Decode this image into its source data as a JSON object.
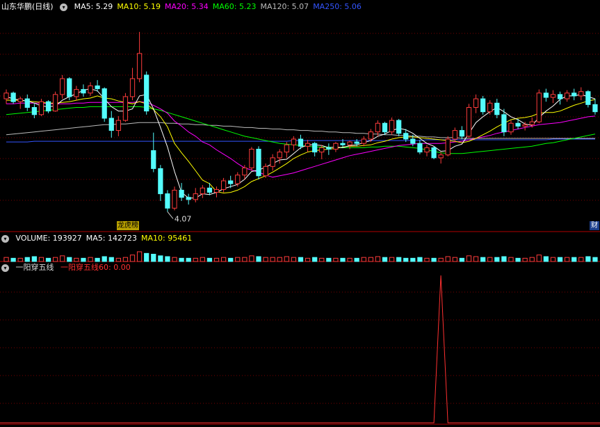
{
  "colors": {
    "up": "#ff3c3c",
    "down": "#54fcfc",
    "grid": "#7a0000",
    "separator": "#b00000",
    "ma5": "#ffffff",
    "ma10": "#ffff00",
    "ma20": "#ff00ff",
    "ma60": "#00ff00",
    "ma120": "#bbbbbb",
    "ma250": "#3355ff",
    "signal": "#ff3030"
  },
  "main": {
    "title": "山东华鹏(日线)",
    "ma_labels": [
      {
        "key": "ma5",
        "text": "MA5: 5.29",
        "color": "#ffffff"
      },
      {
        "key": "ma10",
        "text": "MA10: 5.19",
        "color": "#ffff00"
      },
      {
        "key": "ma20",
        "text": "MA20: 5.34",
        "color": "#ff00ff"
      },
      {
        "key": "ma60",
        "text": "MA60: 5.23",
        "color": "#00ff00"
      },
      {
        "key": "ma120",
        "text": "MA120: 5.07",
        "color": "#bbbbbb"
      },
      {
        "key": "ma250",
        "text": "MA250: 5.06",
        "color": "#3355ff"
      }
    ],
    "low_label": "4.07",
    "badge_left": "龙虎榜",
    "badge_right": "财"
  },
  "volume": {
    "labels": [
      {
        "text": "VOLUME: 193927",
        "color": "#ffffff"
      },
      {
        "text": "MA5: 142723",
        "color": "#ffffff"
      },
      {
        "text": "MA10: 95461",
        "color": "#ffff00"
      }
    ]
  },
  "indicator": {
    "name": "一阳穿五线",
    "value_label": "一阳穿五线60: 0.00"
  },
  "chart_data": {
    "type": "candlestick",
    "price_range": [
      3.9,
      6.8
    ],
    "candles": [
      [
        5.62,
        5.75,
        5.55,
        5.7
      ],
      [
        5.7,
        5.72,
        5.55,
        5.58
      ],
      [
        5.58,
        5.65,
        5.48,
        5.62
      ],
      [
        5.62,
        5.68,
        5.45,
        5.5
      ],
      [
        5.5,
        5.55,
        5.35,
        5.4
      ],
      [
        5.4,
        5.62,
        5.38,
        5.58
      ],
      [
        5.58,
        5.6,
        5.42,
        5.45
      ],
      [
        5.45,
        5.72,
        5.44,
        5.68
      ],
      [
        5.68,
        5.95,
        5.62,
        5.9
      ],
      [
        5.9,
        5.92,
        5.6,
        5.65
      ],
      [
        5.65,
        5.8,
        5.6,
        5.75
      ],
      [
        5.75,
        5.82,
        5.65,
        5.7
      ],
      [
        5.7,
        5.85,
        5.66,
        5.8
      ],
      [
        5.8,
        5.88,
        5.72,
        5.76
      ],
      [
        5.76,
        5.78,
        5.3,
        5.35
      ],
      [
        5.35,
        5.45,
        5.08,
        5.18
      ],
      [
        5.18,
        5.38,
        5.1,
        5.32
      ],
      [
        5.32,
        5.7,
        5.3,
        5.65
      ],
      [
        5.65,
        6.05,
        5.6,
        5.9
      ],
      [
        5.9,
        6.55,
        5.85,
        6.25
      ],
      [
        5.95,
        6.0,
        5.4,
        5.45
      ],
      [
        4.9,
        5.15,
        4.6,
        4.65
      ],
      [
        4.65,
        4.7,
        4.2,
        4.3
      ],
      [
        4.3,
        4.35,
        4.05,
        4.1
      ],
      [
        4.1,
        4.4,
        4.07,
        4.35
      ],
      [
        4.35,
        4.45,
        4.2,
        4.25
      ],
      [
        4.25,
        4.3,
        4.15,
        4.22
      ],
      [
        4.22,
        4.38,
        4.18,
        4.3
      ],
      [
        4.3,
        4.42,
        4.24,
        4.38
      ],
      [
        4.38,
        4.45,
        4.28,
        4.32
      ],
      [
        4.32,
        4.4,
        4.25,
        4.36
      ],
      [
        4.36,
        4.52,
        4.32,
        4.48
      ],
      [
        4.48,
        4.55,
        4.38,
        4.44
      ],
      [
        4.44,
        4.6,
        4.4,
        4.56
      ],
      [
        4.56,
        4.7,
        4.5,
        4.66
      ],
      [
        4.66,
        4.95,
        4.62,
        4.92
      ],
      [
        4.92,
        4.96,
        4.5,
        4.55
      ],
      [
        4.55,
        4.72,
        4.52,
        4.68
      ],
      [
        4.68,
        4.85,
        4.62,
        4.8
      ],
      [
        4.8,
        4.92,
        4.72,
        4.88
      ],
      [
        4.88,
        5.02,
        4.8,
        4.98
      ],
      [
        4.98,
        5.1,
        4.9,
        5.06
      ],
      [
        5.06,
        5.12,
        4.92,
        4.96
      ],
      [
        4.96,
        5.05,
        4.88,
        5.0
      ],
      [
        5.0,
        5.02,
        4.82,
        4.88
      ],
      [
        4.88,
        4.98,
        4.78,
        4.94
      ],
      [
        4.94,
        5.0,
        4.84,
        4.92
      ],
      [
        4.92,
        5.02,
        4.88,
        5.0
      ],
      [
        5.0,
        5.06,
        4.94,
        4.98
      ],
      [
        4.98,
        5.04,
        4.92,
        5.02
      ],
      [
        5.02,
        5.06,
        4.96,
        5.0
      ],
      [
        5.0,
        5.1,
        4.96,
        5.06
      ],
      [
        5.06,
        5.2,
        5.02,
        5.16
      ],
      [
        5.16,
        5.32,
        5.1,
        5.28
      ],
      [
        5.28,
        5.3,
        5.12,
        5.16
      ],
      [
        5.16,
        5.36,
        5.12,
        5.32
      ],
      [
        5.32,
        5.34,
        5.1,
        5.14
      ],
      [
        5.14,
        5.2,
        5.02,
        5.06
      ],
      [
        5.06,
        5.12,
        4.96,
        5.0
      ],
      [
        5.0,
        5.05,
        4.85,
        4.88
      ],
      [
        4.88,
        4.98,
        4.82,
        4.94
      ],
      [
        4.94,
        4.96,
        4.78,
        4.8
      ],
      [
        4.8,
        4.88,
        4.72,
        4.84
      ],
      [
        4.84,
        5.1,
        4.82,
        5.06
      ],
      [
        5.06,
        5.22,
        5.02,
        5.18
      ],
      [
        5.18,
        5.24,
        5.06,
        5.1
      ],
      [
        5.1,
        5.55,
        5.08,
        5.5
      ],
      [
        5.5,
        5.68,
        5.42,
        5.62
      ],
      [
        5.62,
        5.66,
        5.4,
        5.44
      ],
      [
        5.44,
        5.6,
        5.4,
        5.56
      ],
      [
        5.56,
        5.62,
        5.35,
        5.4
      ],
      [
        5.4,
        5.48,
        5.1,
        5.16
      ],
      [
        5.16,
        5.32,
        5.12,
        5.28
      ],
      [
        5.28,
        5.34,
        5.2,
        5.24
      ],
      [
        5.24,
        5.3,
        5.18,
        5.26
      ],
      [
        5.26,
        5.36,
        5.22,
        5.3
      ],
      [
        5.3,
        5.75,
        5.28,
        5.7
      ],
      [
        5.7,
        5.76,
        5.58,
        5.64
      ],
      [
        5.64,
        5.74,
        5.56,
        5.68
      ],
      [
        5.68,
        5.72,
        5.54,
        5.62
      ],
      [
        5.62,
        5.74,
        5.58,
        5.7
      ],
      [
        5.7,
        5.76,
        5.6,
        5.66
      ],
      [
        5.66,
        5.78,
        5.6,
        5.72
      ],
      [
        5.72,
        5.74,
        5.5,
        5.54
      ],
      [
        5.54,
        5.62,
        5.4,
        5.44
      ]
    ],
    "volumes": [
      5,
      4,
      4,
      5,
      6,
      5,
      4,
      5,
      7,
      5,
      4,
      4,
      5,
      4,
      6,
      5,
      4,
      5,
      8,
      12,
      10,
      9,
      7,
      6,
      5,
      4,
      4,
      4,
      5,
      4,
      4,
      5,
      4,
      5,
      5,
      7,
      6,
      5,
      5,
      5,
      6,
      5,
      5,
      4,
      5,
      4,
      4,
      4,
      4,
      4,
      4,
      5,
      5,
      6,
      5,
      5,
      5,
      4,
      4,
      5,
      4,
      4,
      4,
      6,
      5,
      4,
      7,
      6,
      5,
      5,
      5,
      6,
      5,
      4,
      4,
      5,
      8,
      6,
      5,
      5,
      5,
      5,
      5,
      6,
      5
    ],
    "ma_series": {
      "ma5": [
        5.65,
        5.62,
        5.6,
        5.59,
        5.56,
        5.52,
        5.51,
        5.52,
        5.6,
        5.65,
        5.69,
        5.74,
        5.76,
        5.73,
        5.62,
        5.51,
        5.45,
        5.45,
        5.48,
        5.66,
        5.68,
        5.48,
        5.22,
        4.95,
        4.61,
        4.32,
        4.24,
        4.24,
        4.3,
        4.29,
        4.32,
        4.37,
        4.4,
        4.43,
        4.5,
        4.61,
        4.63,
        4.67,
        4.72,
        4.77,
        4.78,
        4.86,
        4.94,
        4.98,
        4.98,
        4.97,
        4.94,
        4.95,
        4.94,
        4.97,
        4.98,
        5.01,
        5.04,
        5.1,
        5.13,
        5.18,
        5.21,
        5.19,
        5.14,
        5.07,
        5.0,
        4.96,
        4.89,
        4.9,
        4.96,
        4.99,
        5.14,
        5.29,
        5.37,
        5.44,
        5.5,
        5.44,
        5.37,
        5.33,
        5.27,
        5.25,
        5.36,
        5.45,
        5.52,
        5.61,
        5.66,
        5.66,
        5.68,
        5.65,
        5.62
      ],
      "ma10": [
        5.6,
        5.6,
        5.6,
        5.59,
        5.58,
        5.57,
        5.56,
        5.56,
        5.57,
        5.58,
        5.6,
        5.62,
        5.63,
        5.66,
        5.63,
        5.62,
        5.59,
        5.57,
        5.55,
        5.58,
        5.55,
        5.47,
        5.37,
        5.23,
        5.0,
        4.87,
        4.75,
        4.62,
        4.49,
        4.44,
        4.33,
        4.31,
        4.32,
        4.35,
        4.4,
        4.47,
        4.51,
        4.55,
        4.6,
        4.66,
        4.72,
        4.79,
        4.84,
        4.88,
        4.9,
        4.91,
        4.92,
        4.93,
        4.95,
        4.96,
        4.96,
        4.97,
        4.98,
        5.01,
        5.03,
        5.06,
        5.08,
        5.09,
        5.09,
        5.08,
        5.07,
        5.06,
        5.05,
        5.04,
        5.03,
        5.01,
        5.03,
        5.07,
        5.12,
        5.17,
        5.23,
        5.28,
        5.33,
        5.35,
        5.36,
        5.38,
        5.42,
        5.43,
        5.43,
        5.45,
        5.49,
        5.53,
        5.56,
        5.59,
        5.61
      ],
      "ma20": [
        5.55,
        5.55,
        5.56,
        5.56,
        5.56,
        5.56,
        5.55,
        5.55,
        5.55,
        5.55,
        5.56,
        5.56,
        5.57,
        5.57,
        5.57,
        5.57,
        5.57,
        5.57,
        5.57,
        5.58,
        5.57,
        5.53,
        5.48,
        5.42,
        5.31,
        5.24,
        5.16,
        5.1,
        5.02,
        4.98,
        4.91,
        4.85,
        4.79,
        4.72,
        4.66,
        4.63,
        4.6,
        4.56,
        4.53,
        4.55,
        4.57,
        4.59,
        4.62,
        4.65,
        4.68,
        4.71,
        4.74,
        4.77,
        4.8,
        4.83,
        4.85,
        4.87,
        4.89,
        4.91,
        4.93,
        4.95,
        4.97,
        4.98,
        4.99,
        5.0,
        5.0,
        5.0,
        5.0,
        5.01,
        5.02,
        5.03,
        5.05,
        5.07,
        5.09,
        5.11,
        5.14,
        5.16,
        5.18,
        5.2,
        5.22,
        5.24,
        5.26,
        5.27,
        5.28,
        5.29,
        5.31,
        5.33,
        5.35,
        5.37,
        5.38
      ],
      "ma60": [
        5.4,
        5.41,
        5.42,
        5.43,
        5.44,
        5.45,
        5.46,
        5.47,
        5.48,
        5.49,
        5.5,
        5.5,
        5.51,
        5.51,
        5.51,
        5.51,
        5.51,
        5.51,
        5.51,
        5.51,
        5.5,
        5.48,
        5.46,
        5.43,
        5.4,
        5.37,
        5.34,
        5.31,
        5.28,
        5.25,
        5.22,
        5.19,
        5.16,
        5.13,
        5.1,
        5.08,
        5.06,
        5.04,
        5.02,
        5.0,
        4.99,
        4.98,
        4.97,
        4.96,
        4.95,
        4.95,
        4.95,
        4.94,
        4.94,
        4.94,
        4.94,
        4.94,
        4.95,
        4.95,
        4.96,
        4.96,
        4.96,
        4.95,
        4.94,
        4.93,
        4.91,
        4.89,
        4.87,
        4.86,
        4.86,
        4.86,
        4.87,
        4.88,
        4.89,
        4.9,
        4.91,
        4.92,
        4.93,
        4.94,
        4.95,
        4.96,
        4.98,
        5.0,
        5.01,
        5.03,
        5.05,
        5.07,
        5.09,
        5.11,
        5.13
      ],
      "ma120": [
        5.12,
        5.13,
        5.14,
        5.15,
        5.16,
        5.17,
        5.18,
        5.19,
        5.2,
        5.21,
        5.22,
        5.23,
        5.24,
        5.25,
        5.26,
        5.26,
        5.27,
        5.27,
        5.28,
        5.29,
        5.29,
        5.29,
        5.29,
        5.28,
        5.28,
        5.27,
        5.27,
        5.26,
        5.26,
        5.25,
        5.25,
        5.24,
        5.24,
        5.23,
        5.22,
        5.22,
        5.21,
        5.21,
        5.2,
        5.2,
        5.19,
        5.19,
        5.18,
        5.18,
        5.17,
        5.17,
        5.16,
        5.16,
        5.15,
        5.15,
        5.14,
        5.14,
        5.13,
        5.13,
        5.12,
        5.12,
        5.11,
        5.11,
        5.1,
        5.1,
        5.09,
        5.09,
        5.08,
        5.08,
        5.08,
        5.07,
        5.07,
        5.07,
        5.07,
        5.07,
        5.07,
        5.07,
        5.07,
        5.07,
        5.07,
        5.07,
        5.07,
        5.07,
        5.07,
        5.07,
        5.07,
        5.07,
        5.07,
        5.07,
        5.07
      ],
      "ma250": [
        5.02,
        5.02,
        5.02,
        5.02,
        5.03,
        5.03,
        5.03,
        5.03,
        5.03,
        5.03,
        5.03,
        5.03,
        5.03,
        5.03,
        5.03,
        5.03,
        5.03,
        5.03,
        5.03,
        5.03,
        5.03,
        5.03,
        5.03,
        5.03,
        5.03,
        5.03,
        5.03,
        5.03,
        5.03,
        5.03,
        5.03,
        5.03,
        5.03,
        5.03,
        5.03,
        5.03,
        5.03,
        5.03,
        5.03,
        5.03,
        5.03,
        5.04,
        5.04,
        5.04,
        5.04,
        5.04,
        5.04,
        5.04,
        5.04,
        5.04,
        5.04,
        5.04,
        5.04,
        5.04,
        5.04,
        5.04,
        5.04,
        5.04,
        5.04,
        5.04,
        5.05,
        5.05,
        5.05,
        5.05,
        5.05,
        5.05,
        5.05,
        5.05,
        5.05,
        5.05,
        5.05,
        5.05,
        5.05,
        5.05,
        5.05,
        5.05,
        5.05,
        5.05,
        5.06,
        5.06,
        5.06,
        5.06,
        5.06,
        5.06,
        5.06
      ]
    },
    "signal_index": 62,
    "signal_value": 1
  }
}
